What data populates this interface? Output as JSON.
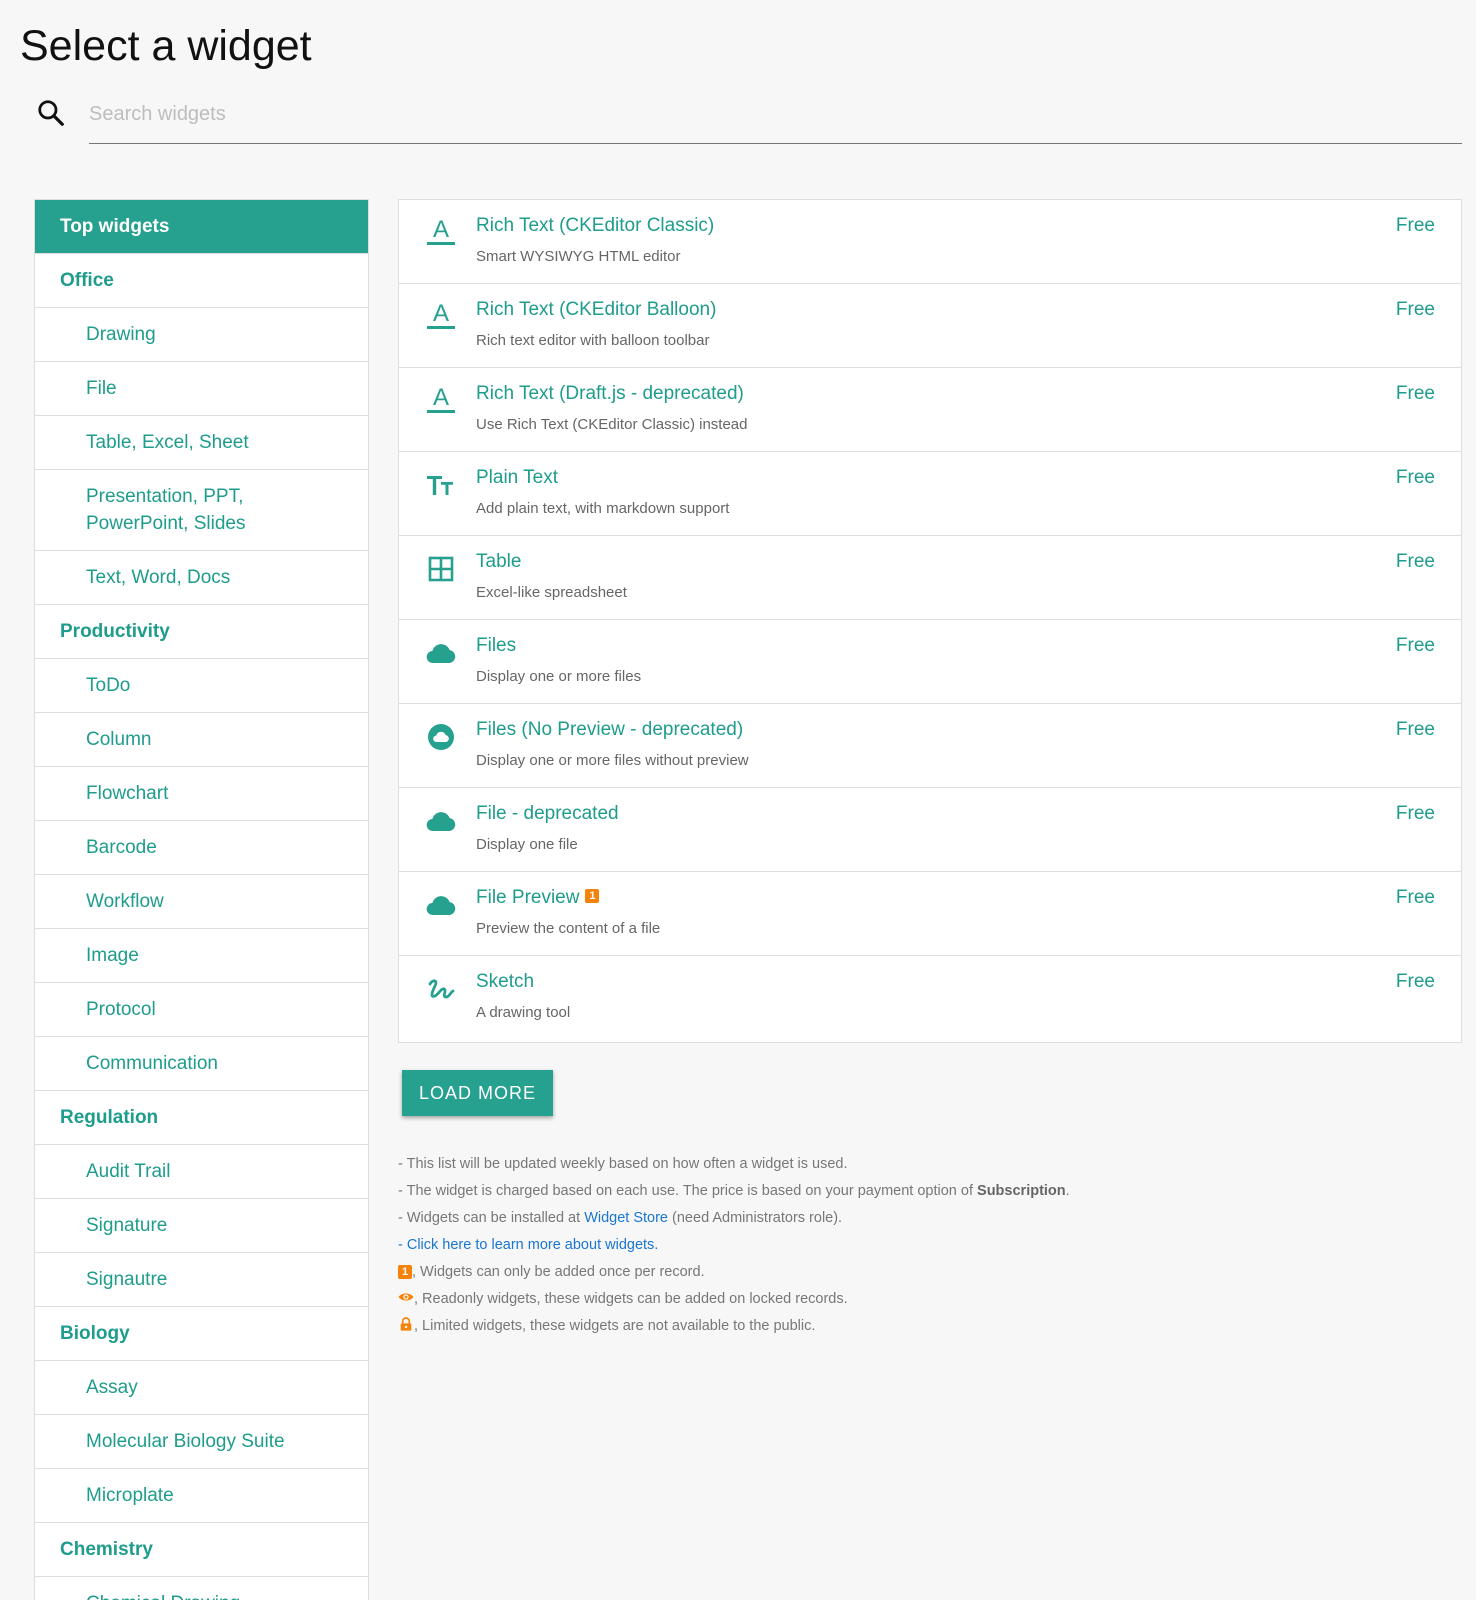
{
  "page": {
    "title": "Select a widget"
  },
  "search": {
    "placeholder": "Search widgets",
    "value": ""
  },
  "sidebar": {
    "items": [
      {
        "label": "Top widgets",
        "kind": "group",
        "active": true
      },
      {
        "label": "Office",
        "kind": "group"
      },
      {
        "label": "Drawing",
        "kind": "sub"
      },
      {
        "label": "File",
        "kind": "sub"
      },
      {
        "label": "Table, Excel, Sheet",
        "kind": "sub"
      },
      {
        "label": "Presentation, PPT, PowerPoint, Slides",
        "kind": "sub"
      },
      {
        "label": "Text, Word, Docs",
        "kind": "sub"
      },
      {
        "label": "Productivity",
        "kind": "group"
      },
      {
        "label": "ToDo",
        "kind": "sub"
      },
      {
        "label": "Column",
        "kind": "sub"
      },
      {
        "label": "Flowchart",
        "kind": "sub"
      },
      {
        "label": "Barcode",
        "kind": "sub"
      },
      {
        "label": "Workflow",
        "kind": "sub"
      },
      {
        "label": "Image",
        "kind": "sub"
      },
      {
        "label": "Protocol",
        "kind": "sub"
      },
      {
        "label": "Communication",
        "kind": "sub"
      },
      {
        "label": "Regulation",
        "kind": "group"
      },
      {
        "label": "Audit Trail",
        "kind": "sub"
      },
      {
        "label": "Signature",
        "kind": "sub"
      },
      {
        "label": "Signautre",
        "kind": "sub"
      },
      {
        "label": "Biology",
        "kind": "group"
      },
      {
        "label": "Assay",
        "kind": "sub"
      },
      {
        "label": "Molecular Biology Suite",
        "kind": "sub"
      },
      {
        "label": "Microplate",
        "kind": "sub"
      },
      {
        "label": "Chemistry",
        "kind": "group"
      },
      {
        "label": "Chemical Drawing",
        "kind": "sub"
      }
    ]
  },
  "widgets": [
    {
      "name": "Rich Text (CKEditor Classic)",
      "desc": "Smart WYSIWYG HTML editor",
      "price": "Free",
      "icon": "text-format-icon"
    },
    {
      "name": "Rich Text (CKEditor Balloon)",
      "desc": "Rich text editor with balloon toolbar",
      "price": "Free",
      "icon": "text-format-icon"
    },
    {
      "name": "Rich Text (Draft.js - deprecated)",
      "desc": "Use Rich Text (CKEditor Classic) instead",
      "price": "Free",
      "icon": "text-format-icon"
    },
    {
      "name": "Plain Text",
      "desc": "Add plain text, with markdown support",
      "price": "Free",
      "icon": "text-size-icon"
    },
    {
      "name": "Table",
      "desc": "Excel-like spreadsheet",
      "price": "Free",
      "icon": "grid-table-icon"
    },
    {
      "name": "Files",
      "desc": "Display one or more files",
      "price": "Free",
      "icon": "cloud-icon"
    },
    {
      "name": "Files (No Preview - deprecated)",
      "desc": "Display one or more files without preview",
      "price": "Free",
      "icon": "cloud-circle-icon"
    },
    {
      "name": "File - deprecated",
      "desc": "Display one file",
      "price": "Free",
      "icon": "cloud-icon"
    },
    {
      "name": "File Preview",
      "desc": "Preview the content of a file",
      "price": "Free",
      "icon": "cloud-icon",
      "badge": "1"
    },
    {
      "name": "Sketch",
      "desc": "A drawing tool",
      "price": "Free",
      "icon": "sketch-scribble-icon"
    }
  ],
  "load_more": {
    "label": "LOAD MORE"
  },
  "notes": {
    "n1": "- This list will be updated weekly based on how often a widget is used.",
    "n2_pre": "- The widget is charged based on each use. The price is based on your payment option of ",
    "n2_bold": "Subscription",
    "n2_post": ".",
    "n3_pre": "- Widgets can be installed at ",
    "n3_link": "Widget Store",
    "n3_post": " (need Administrators role).",
    "n4_pre": "- ",
    "n4_link": "Click here to learn more about widgets.",
    "legend_once_badge": "1",
    "legend_once": ", Widgets can only be added once per record.",
    "legend_readonly": ", Readonly widgets, these widgets can be added on locked records.",
    "legend_limited": ", Limited widgets, these widgets are not available to the public."
  },
  "colors": {
    "accent": "#26a08f",
    "accent_text": "#1e9c8c",
    "badge_orange": "#f5830b",
    "link": "#1976d2"
  }
}
